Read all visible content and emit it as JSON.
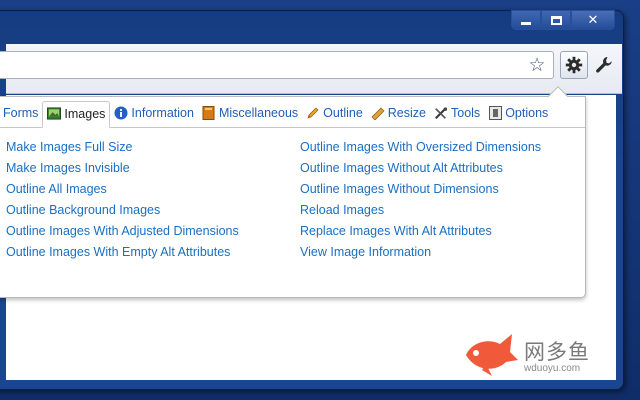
{
  "window": {
    "minimize_label": "",
    "maximize_label": "",
    "close_label": "✕"
  },
  "toolbar": {
    "star_icon": "star-icon",
    "gear_icon": "gear-icon",
    "wrench_icon": "wrench-icon"
  },
  "tabs": [
    {
      "label": "Forms",
      "icon": "none",
      "active": false
    },
    {
      "label": "Images",
      "icon": "images-icon",
      "active": true
    },
    {
      "label": "Information",
      "icon": "info-icon",
      "active": false
    },
    {
      "label": "Miscellaneous",
      "icon": "book-icon",
      "active": false
    },
    {
      "label": "Outline",
      "icon": "pencil-icon",
      "active": false
    },
    {
      "label": "Resize",
      "icon": "ruler-icon",
      "active": false
    },
    {
      "label": "Tools",
      "icon": "tools-icon",
      "active": false
    },
    {
      "label": "Options",
      "icon": "options-icon",
      "active": false
    }
  ],
  "images_menu": {
    "left": [
      "Make Images Full Size",
      "Make Images Invisible",
      "Outline All Images",
      "Outline Background Images",
      "Outline Images With Adjusted Dimensions",
      "Outline Images With Empty Alt Attributes"
    ],
    "right": [
      "Outline Images With Oversized Dimensions",
      "Outline Images Without Alt Attributes",
      "Outline Images Without Dimensions",
      "Reload Images",
      "Replace Images With Alt Attributes",
      "View Image Information"
    ]
  },
  "watermark": {
    "title": "网多鱼",
    "sub": "wduoyu.com"
  },
  "colors": {
    "link": "#1a6fc3",
    "frame": "#1b4591",
    "watermark_fish": "#f05a3a"
  }
}
